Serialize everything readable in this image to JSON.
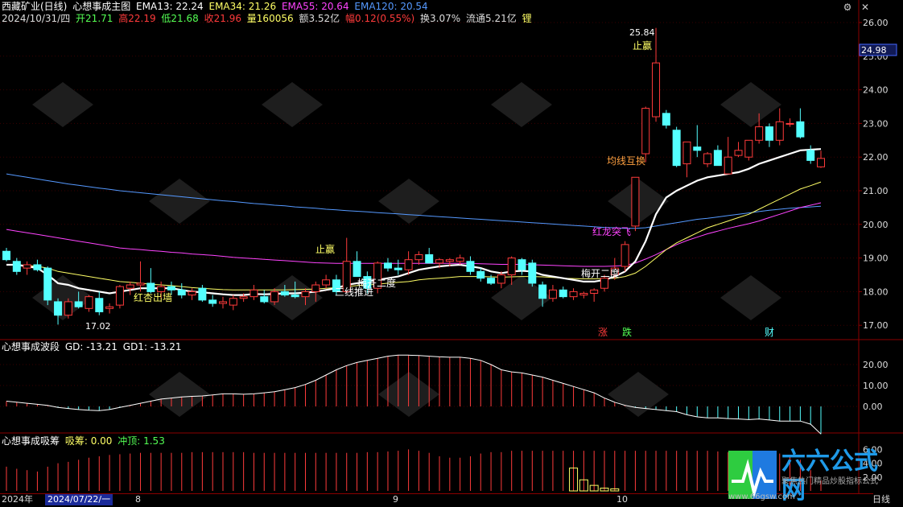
{
  "header": {
    "stock_name": "西藏矿业(日线)",
    "indicator_name": "心想事成主图",
    "ema13": "EMA13: 22.24",
    "ema34": "EMA34: 21.26",
    "ema55": "EMA55: 20.64",
    "ema120": "EMA120: 20.54",
    "date": "2024/10/31/四",
    "open": "开21.71",
    "high": "高22.19",
    "low": "低21.68",
    "close": "收21.96",
    "volume": "量160056",
    "amount": "额3.52亿",
    "change": "幅0.12(0.55%)",
    "turnover": "换3.07%",
    "float": "流通5.21亿",
    "lock_label": "锂"
  },
  "colors": {
    "up": "#ff3b3b",
    "down": "#54ffff",
    "ema13": "#ffffff",
    "ema34": "#ffff66",
    "ema55": "#ff44ff",
    "ema120": "#5599ff",
    "axis": "#8b0000",
    "tag_orange": "#ffa040"
  },
  "icons": {
    "close": "close-icon",
    "settings": "gear-icon",
    "arrow": "arrow-icon"
  },
  "main_axis": {
    "ticks": [
      "26.00",
      "25.00",
      "24.00",
      "23.00",
      "22.00",
      "21.00",
      "20.00",
      "19.00",
      "18.00",
      "17.00"
    ],
    "tick_values": [
      26,
      25,
      24,
      23,
      22,
      21,
      20,
      19,
      18,
      17
    ],
    "current_price": "24.98"
  },
  "annotations": {
    "high_label": "25.84",
    "low_label": "17.02",
    "stop_win_1": "止赢",
    "stop_win_2": "止赢",
    "red_apricot": "红杏出墙",
    "three_line": "三线推进",
    "plum_1": "梅开二度",
    "plum_2": "梅开二度",
    "ma_swap": "均线互换",
    "dragon": "红龙突飞",
    "tag_zhang": "涨",
    "tag_die": "跌",
    "tag_cai": "财"
  },
  "panel2": {
    "title": "心想事成波段",
    "gd": "GD: -13.21",
    "gd1": "GD1: -13.21",
    "ticks": [
      "20.00",
      "10.00",
      "0.00"
    ],
    "tick_values": [
      20,
      10,
      0
    ]
  },
  "panel3": {
    "title": "心想事成吸筹",
    "absorb": "吸筹: 0.00",
    "rush": "冲顶: 1.53",
    "ticks": [
      "6.00",
      "4.00",
      "2.00"
    ]
  },
  "xaxis": {
    "year": "2024年",
    "date_box": "2024/07/22/一",
    "m8": "8",
    "m9": "9",
    "m10": "10",
    "period": "日线"
  },
  "logo": {
    "title": "六六公式网",
    "subtitle": "聚焦热门精品炒股指标公式",
    "url": "www.66gsw.com"
  },
  "chart_data": {
    "type": "candlestick",
    "candles": [
      {
        "o": 19.2,
        "h": 19.3,
        "l": 18.9,
        "c": 18.95
      },
      {
        "o": 18.9,
        "h": 19.0,
        "l": 18.5,
        "c": 18.6
      },
      {
        "o": 18.7,
        "h": 18.9,
        "l": 18.5,
        "c": 18.8
      },
      {
        "o": 18.8,
        "h": 18.95,
        "l": 18.6,
        "c": 18.65
      },
      {
        "o": 18.7,
        "h": 18.75,
        "l": 17.6,
        "c": 17.75
      },
      {
        "o": 17.7,
        "h": 17.8,
        "l": 17.02,
        "c": 17.3
      },
      {
        "o": 17.3,
        "h": 17.8,
        "l": 17.2,
        "c": 17.7
      },
      {
        "o": 17.7,
        "h": 18.0,
        "l": 17.5,
        "c": 17.55
      },
      {
        "o": 17.5,
        "h": 17.9,
        "l": 17.4,
        "c": 17.85
      },
      {
        "o": 17.8,
        "h": 18.0,
        "l": 17.3,
        "c": 17.4
      },
      {
        "o": 17.5,
        "h": 17.65,
        "l": 17.35,
        "c": 17.55
      },
      {
        "o": 17.6,
        "h": 18.2,
        "l": 17.5,
        "c": 18.15
      },
      {
        "o": 18.1,
        "h": 18.3,
        "l": 17.9,
        "c": 18.2
      },
      {
        "o": 18.2,
        "h": 18.9,
        "l": 18.0,
        "c": 18.25
      },
      {
        "o": 18.25,
        "h": 18.7,
        "l": 17.95,
        "c": 18.0
      },
      {
        "o": 18.0,
        "h": 18.3,
        "l": 17.8,
        "c": 18.15
      },
      {
        "o": 18.15,
        "h": 18.3,
        "l": 17.9,
        "c": 18.05
      },
      {
        "o": 18.05,
        "h": 18.25,
        "l": 17.8,
        "c": 17.9
      },
      {
        "o": 17.9,
        "h": 18.1,
        "l": 17.75,
        "c": 18.0
      },
      {
        "o": 18.1,
        "h": 18.2,
        "l": 17.7,
        "c": 17.75
      },
      {
        "o": 17.75,
        "h": 17.9,
        "l": 17.55,
        "c": 17.65
      },
      {
        "o": 17.65,
        "h": 17.85,
        "l": 17.5,
        "c": 17.7
      },
      {
        "o": 17.6,
        "h": 17.9,
        "l": 17.45,
        "c": 17.8
      },
      {
        "o": 17.8,
        "h": 17.95,
        "l": 17.7,
        "c": 17.85
      },
      {
        "o": 17.85,
        "h": 18.2,
        "l": 17.75,
        "c": 18.05
      },
      {
        "o": 17.85,
        "h": 18.05,
        "l": 17.65,
        "c": 17.7
      },
      {
        "o": 17.7,
        "h": 18.1,
        "l": 17.6,
        "c": 18.0
      },
      {
        "o": 18.0,
        "h": 18.2,
        "l": 17.85,
        "c": 17.9
      },
      {
        "o": 17.9,
        "h": 18.3,
        "l": 17.8,
        "c": 17.85
      },
      {
        "o": 17.85,
        "h": 18.1,
        "l": 17.6,
        "c": 18.0
      },
      {
        "o": 18.0,
        "h": 18.3,
        "l": 17.7,
        "c": 18.2
      },
      {
        "o": 18.2,
        "h": 18.5,
        "l": 18.1,
        "c": 18.35
      },
      {
        "o": 18.35,
        "h": 18.5,
        "l": 17.9,
        "c": 18.0
      },
      {
        "o": 18.0,
        "h": 19.6,
        "l": 17.95,
        "c": 18.9
      },
      {
        "o": 18.9,
        "h": 19.2,
        "l": 18.6,
        "c": 18.45
      },
      {
        "o": 18.45,
        "h": 18.6,
        "l": 17.95,
        "c": 18.1
      },
      {
        "o": 18.1,
        "h": 18.9,
        "l": 17.95,
        "c": 18.85
      },
      {
        "o": 18.85,
        "h": 19.0,
        "l": 18.6,
        "c": 18.7
      },
      {
        "o": 18.7,
        "h": 18.95,
        "l": 18.5,
        "c": 18.65
      },
      {
        "o": 18.65,
        "h": 19.2,
        "l": 18.5,
        "c": 18.95
      },
      {
        "o": 18.95,
        "h": 19.2,
        "l": 18.8,
        "c": 19.1
      },
      {
        "o": 19.1,
        "h": 19.3,
        "l": 18.9,
        "c": 18.85
      },
      {
        "o": 18.85,
        "h": 19.0,
        "l": 18.7,
        "c": 18.95
      },
      {
        "o": 18.9,
        "h": 19.0,
        "l": 18.75,
        "c": 18.95
      },
      {
        "o": 18.9,
        "h": 19.1,
        "l": 18.8,
        "c": 19.0
      },
      {
        "o": 18.9,
        "h": 19.05,
        "l": 18.5,
        "c": 18.6
      },
      {
        "o": 18.6,
        "h": 18.7,
        "l": 18.3,
        "c": 18.4
      },
      {
        "o": 18.4,
        "h": 18.5,
        "l": 18.2,
        "c": 18.25
      },
      {
        "o": 18.25,
        "h": 18.6,
        "l": 18.1,
        "c": 18.5
      },
      {
        "o": 18.5,
        "h": 19.05,
        "l": 18.2,
        "c": 19.0
      },
      {
        "o": 18.95,
        "h": 19.0,
        "l": 18.5,
        "c": 18.65
      },
      {
        "o": 18.85,
        "h": 18.95,
        "l": 18.15,
        "c": 18.25
      },
      {
        "o": 18.2,
        "h": 18.3,
        "l": 17.55,
        "c": 17.8
      },
      {
        "o": 17.8,
        "h": 18.2,
        "l": 17.7,
        "c": 18.05
      },
      {
        "o": 18.05,
        "h": 18.15,
        "l": 17.8,
        "c": 17.85
      },
      {
        "o": 17.85,
        "h": 18.1,
        "l": 17.75,
        "c": 18.0
      },
      {
        "o": 17.9,
        "h": 18.0,
        "l": 17.8,
        "c": 17.95
      },
      {
        "o": 17.95,
        "h": 18.1,
        "l": 17.7,
        "c": 18.05
      },
      {
        "o": 18.1,
        "h": 18.5,
        "l": 18.0,
        "c": 18.4
      },
      {
        "o": 18.5,
        "h": 19.0,
        "l": 18.35,
        "c": 18.7
      },
      {
        "o": 18.75,
        "h": 19.5,
        "l": 18.6,
        "c": 19.4
      },
      {
        "o": 19.95,
        "h": 21.4,
        "l": 19.8,
        "c": 21.4
      },
      {
        "o": 22.1,
        "h": 23.5,
        "l": 21.85,
        "c": 23.45
      },
      {
        "o": 23.2,
        "h": 25.84,
        "l": 23.05,
        "c": 24.8
      },
      {
        "o": 23.3,
        "h": 23.4,
        "l": 22.85,
        "c": 22.95
      },
      {
        "o": 22.8,
        "h": 22.9,
        "l": 21.7,
        "c": 21.75
      },
      {
        "o": 21.8,
        "h": 22.45,
        "l": 21.4,
        "c": 22.45
      },
      {
        "o": 22.3,
        "h": 22.95,
        "l": 22.0,
        "c": 22.2
      },
      {
        "o": 21.8,
        "h": 22.15,
        "l": 21.7,
        "c": 22.1
      },
      {
        "o": 22.2,
        "h": 22.35,
        "l": 21.75,
        "c": 21.75
      },
      {
        "o": 21.5,
        "h": 22.6,
        "l": 21.5,
        "c": 22.0
      },
      {
        "o": 22.05,
        "h": 22.45,
        "l": 22.0,
        "c": 22.2
      },
      {
        "o": 22.0,
        "h": 22.5,
        "l": 21.9,
        "c": 22.5
      },
      {
        "o": 22.5,
        "h": 23.3,
        "l": 22.4,
        "c": 22.9
      },
      {
        "o": 22.9,
        "h": 23.0,
        "l": 22.3,
        "c": 22.5
      },
      {
        "o": 22.5,
        "h": 23.45,
        "l": 22.35,
        "c": 23.05
      },
      {
        "o": 23.0,
        "h": 23.15,
        "l": 22.9,
        "c": 23.0
      },
      {
        "o": 23.05,
        "h": 23.45,
        "l": 22.55,
        "c": 22.6
      },
      {
        "o": 22.2,
        "h": 22.35,
        "l": 21.8,
        "c": 21.9
      },
      {
        "o": 21.71,
        "h": 22.19,
        "l": 21.68,
        "c": 21.96
      }
    ],
    "ema13": [
      18.8,
      18.8,
      18.75,
      18.7,
      18.5,
      18.25,
      18.2,
      18.1,
      18.05,
      18.0,
      17.95,
      18.0,
      18.05,
      18.1,
      18.1,
      18.1,
      18.1,
      18.05,
      18.0,
      17.98,
      17.95,
      17.92,
      17.9,
      17.9,
      17.93,
      17.92,
      17.93,
      17.95,
      17.95,
      17.97,
      18.0,
      18.05,
      18.1,
      18.2,
      18.25,
      18.3,
      18.35,
      18.4,
      18.45,
      18.55,
      18.65,
      18.7,
      18.75,
      18.78,
      18.8,
      18.75,
      18.7,
      18.6,
      18.55,
      18.6,
      18.62,
      18.6,
      18.5,
      18.45,
      18.4,
      18.35,
      18.3,
      18.3,
      18.35,
      18.45,
      18.6,
      18.9,
      19.5,
      20.3,
      20.8,
      21.0,
      21.15,
      21.3,
      21.4,
      21.45,
      21.5,
      21.55,
      21.65,
      21.8,
      21.9,
      22.0,
      22.1,
      22.2,
      22.22,
      22.24
    ],
    "ema34": [
      18.8,
      18.8,
      18.78,
      18.75,
      18.7,
      18.6,
      18.55,
      18.5,
      18.45,
      18.4,
      18.35,
      18.3,
      18.28,
      18.25,
      18.22,
      18.2,
      18.18,
      18.15,
      18.12,
      18.1,
      18.08,
      18.06,
      18.05,
      18.05,
      18.05,
      18.05,
      18.05,
      18.05,
      18.06,
      18.07,
      18.08,
      18.1,
      18.12,
      18.15,
      18.18,
      18.2,
      18.22,
      18.25,
      18.28,
      18.3,
      18.35,
      18.38,
      18.4,
      18.42,
      18.45,
      18.45,
      18.45,
      18.44,
      18.43,
      18.44,
      18.45,
      18.45,
      18.44,
      18.42,
      18.4,
      18.39,
      18.38,
      18.38,
      18.39,
      18.4,
      18.45,
      18.55,
      18.75,
      19.0,
      19.25,
      19.45,
      19.6,
      19.75,
      19.9,
      20.0,
      20.1,
      20.2,
      20.3,
      20.45,
      20.6,
      20.75,
      20.9,
      21.05,
      21.15,
      21.26
    ],
    "ema55": [
      19.85,
      19.8,
      19.75,
      19.7,
      19.65,
      19.6,
      19.55,
      19.5,
      19.45,
      19.4,
      19.35,
      19.3,
      19.27,
      19.25,
      19.22,
      19.2,
      19.17,
      19.15,
      19.12,
      19.1,
      19.08,
      19.05,
      19.02,
      19.0,
      18.98,
      18.96,
      18.94,
      18.92,
      18.9,
      18.88,
      18.86,
      18.85,
      18.84,
      18.84,
      18.84,
      18.84,
      18.84,
      18.84,
      18.84,
      18.84,
      18.84,
      18.84,
      18.84,
      18.84,
      18.84,
      18.84,
      18.83,
      18.82,
      18.81,
      18.81,
      18.81,
      18.8,
      18.79,
      18.78,
      18.77,
      18.76,
      18.75,
      18.75,
      18.75,
      18.76,
      18.78,
      18.85,
      18.97,
      19.1,
      19.25,
      19.4,
      19.52,
      19.62,
      19.72,
      19.8,
      19.88,
      19.95,
      20.02,
      20.1,
      20.2,
      20.3,
      20.4,
      20.5,
      20.57,
      20.64
    ],
    "ema120": [
      21.5,
      21.45,
      21.4,
      21.35,
      21.3,
      21.25,
      21.2,
      21.16,
      21.12,
      21.08,
      21.04,
      21.0,
      20.97,
      20.94,
      20.91,
      20.88,
      20.85,
      20.82,
      20.79,
      20.76,
      20.73,
      20.7,
      20.68,
      20.65,
      20.62,
      20.6,
      20.57,
      20.55,
      20.52,
      20.5,
      20.48,
      20.45,
      20.43,
      20.41,
      20.39,
      20.37,
      20.35,
      20.33,
      20.31,
      20.29,
      20.27,
      20.25,
      20.23,
      20.21,
      20.19,
      20.17,
      20.15,
      20.13,
      20.11,
      20.09,
      20.07,
      20.05,
      20.03,
      20.01,
      19.99,
      19.97,
      19.95,
      19.93,
      19.91,
      19.9,
      19.88,
      19.88,
      19.9,
      19.95,
      20.0,
      20.05,
      20.1,
      20.15,
      20.18,
      20.22,
      20.26,
      20.3,
      20.34,
      20.38,
      20.42,
      20.45,
      20.48,
      20.5,
      20.52,
      20.54
    ],
    "wave": [
      2.5,
      2.0,
      1.5,
      1.0,
      0.5,
      -0.5,
      -1.0,
      -1.5,
      -1.8,
      -2.0,
      -1.5,
      -0.5,
      0.5,
      1.5,
      2.5,
      3.5,
      4.0,
      4.5,
      4.8,
      5.0,
      5.5,
      6.0,
      6.0,
      5.8,
      6.0,
      6.5,
      7.0,
      8.0,
      9.0,
      10.5,
      12.5,
      15.0,
      17.5,
      19.5,
      21.0,
      22.0,
      23.0,
      24.0,
      24.5,
      24.5,
      24.3,
      24.0,
      23.7,
      23.5,
      23.5,
      23.0,
      22.0,
      20.0,
      17.5,
      16.5,
      16.0,
      15.0,
      14.0,
      12.5,
      11.0,
      9.5,
      8.0,
      6.5,
      4.0,
      2.0,
      0.5,
      -0.5,
      -1.0,
      -1.5,
      -2.0,
      -2.5,
      -4.0,
      -5.0,
      -5.5,
      -5.5,
      -5.8,
      -6.0,
      -6.3,
      -6.0,
      -6.5,
      -7.0,
      -7.0,
      -7.0,
      -8.5,
      -13.21
    ],
    "absorb": [
      0,
      0,
      0,
      0,
      0,
      0,
      0,
      0,
      0,
      0,
      0,
      0,
      0,
      0,
      0,
      0,
      0,
      0,
      0,
      0,
      0,
      0,
      0,
      0,
      0,
      0,
      0,
      0,
      0,
      0,
      0,
      0,
      0,
      0,
      0,
      0,
      0,
      0,
      0,
      0,
      0,
      0,
      0,
      0,
      0,
      0,
      0,
      0,
      0,
      0,
      0,
      0,
      0,
      0,
      0,
      3.3,
      1.6,
      0.8,
      0.4,
      0.3,
      0,
      0,
      0,
      0,
      0,
      0,
      0,
      0,
      0,
      0,
      0,
      0,
      0,
      0,
      0,
      0,
      0,
      0,
      0,
      0
    ],
    "rush": [
      3.5,
      3.2,
      3.0,
      2.8,
      3.5,
      4.0,
      4.2,
      4.5,
      4.8,
      5.0,
      5.2,
      5.3,
      5.4,
      5.5,
      5.5,
      5.5,
      5.5,
      5.5,
      5.6,
      5.6,
      5.6,
      5.6,
      5.6,
      5.6,
      5.5,
      5.5,
      5.5,
      5.5,
      5.5,
      5.5,
      5.5,
      5.5,
      5.5,
      5.5,
      5.5,
      5.6,
      5.6,
      5.7,
      5.8,
      6.0,
      5.8,
      5.5,
      5.0,
      4.8,
      4.8,
      5.0,
      5.4,
      5.6,
      5.6,
      5.8,
      5.8,
      5.8,
      5.8,
      5.8,
      5.8,
      5.8,
      5.8,
      5.8,
      5.8,
      5.8,
      5.8,
      5.8,
      5.8,
      5.8,
      5.8,
      5.8,
      5.8,
      5.8,
      5.8,
      5.7,
      5.6,
      5.6,
      5.5,
      5.5,
      5.5,
      5.4,
      5.2,
      4.5,
      3.0,
      1.53
    ]
  }
}
